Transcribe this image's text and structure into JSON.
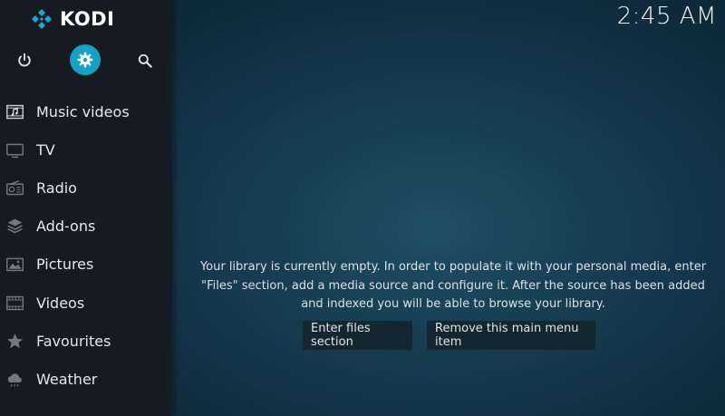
{
  "app": {
    "logo_text": "KODI",
    "clock": "2:45 AM"
  },
  "top_icons": [
    "power-icon",
    "settings-icon",
    "search-icon"
  ],
  "menu": {
    "items": [
      {
        "label": "Music videos",
        "icon": "music-videos-icon"
      },
      {
        "label": "TV",
        "icon": "tv-icon"
      },
      {
        "label": "Radio",
        "icon": "radio-icon"
      },
      {
        "label": "Add-ons",
        "icon": "addons-icon"
      },
      {
        "label": "Pictures",
        "icon": "pictures-icon"
      },
      {
        "label": "Videos",
        "icon": "videos-icon"
      },
      {
        "label": "Favourites",
        "icon": "favourites-icon"
      },
      {
        "label": "Weather",
        "icon": "weather-icon"
      }
    ]
  },
  "main": {
    "message": "Your library is currently empty. In order to populate it with your personal media, enter \"Files\" section, add a media source and configure it. After the source has been added and indexed you will be able to browse your library.",
    "enter_files_label": "Enter files section",
    "remove_item_label": "Remove this main menu item"
  },
  "colors": {
    "accent": "#12a2c6",
    "sidebar_bg": "#151b20",
    "background": "#173d52"
  }
}
